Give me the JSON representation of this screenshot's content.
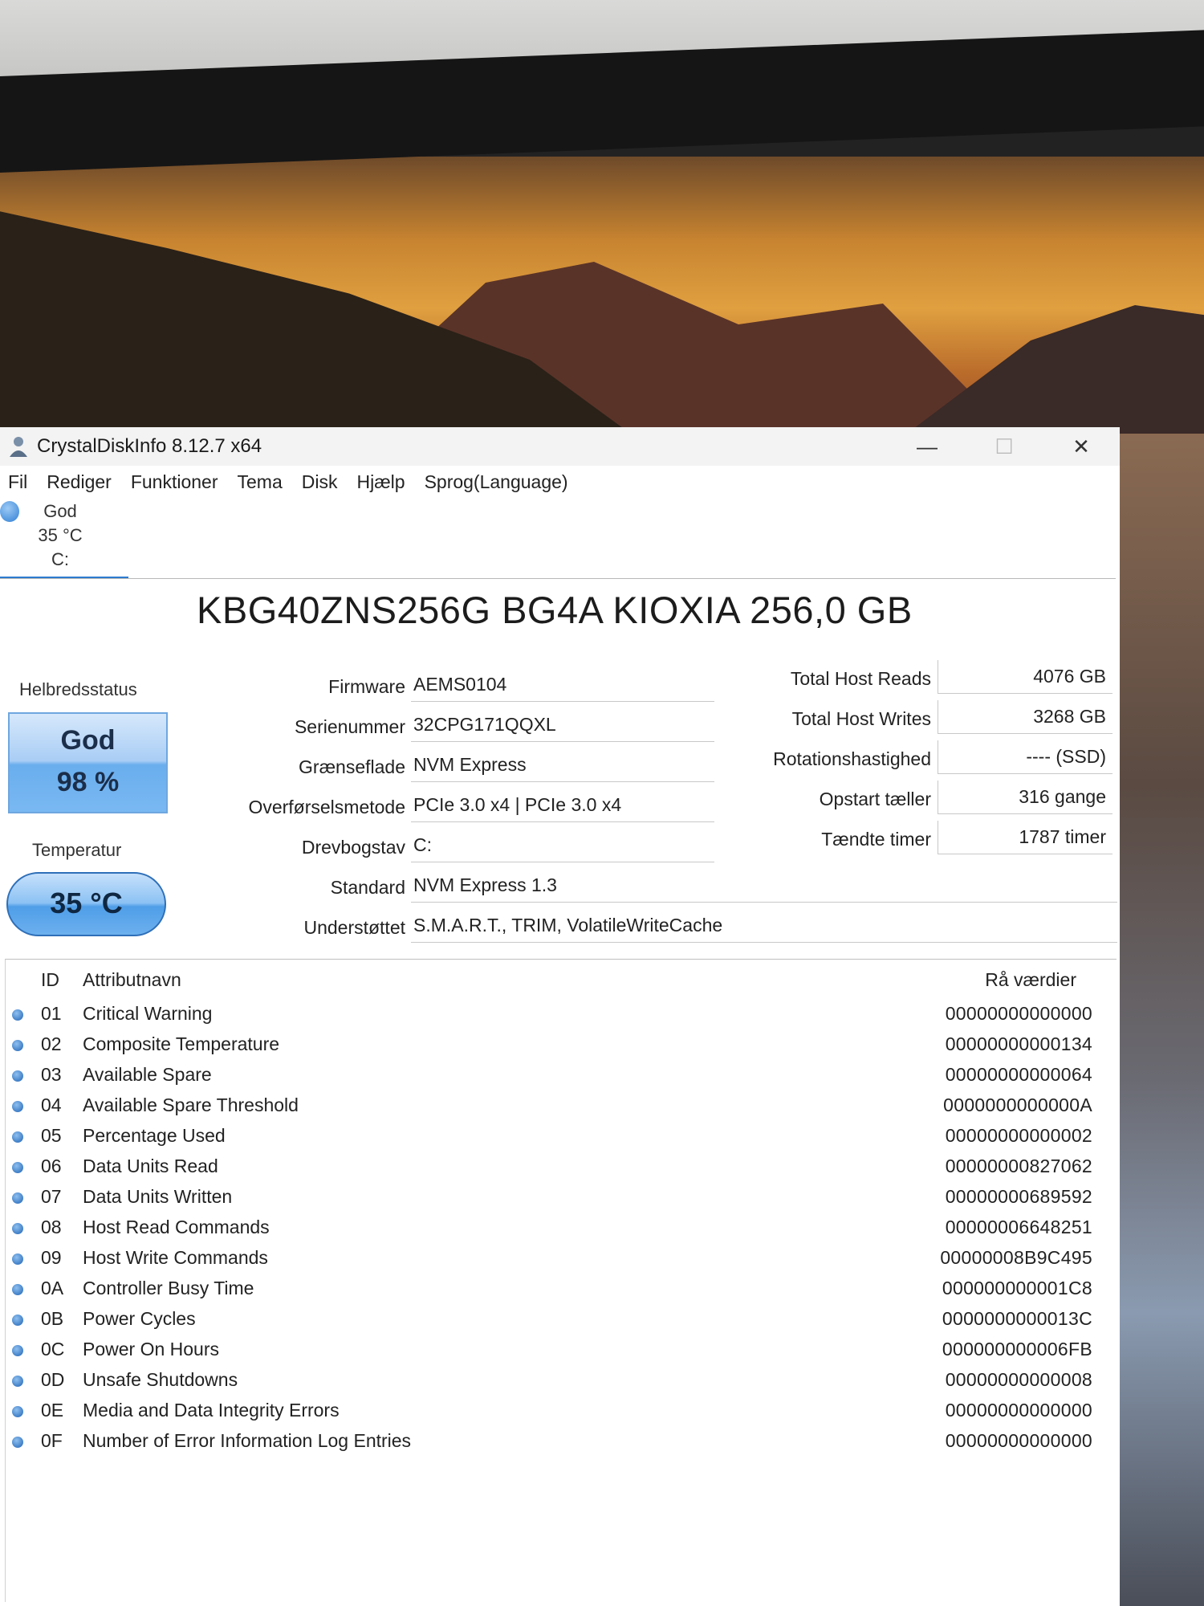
{
  "window": {
    "title": "CrystalDiskInfo 8.12.7 x64",
    "controls": {
      "minimize": "—",
      "maximize": "☐",
      "close": "✕"
    }
  },
  "menu": [
    "Fil",
    "Rediger",
    "Funktioner",
    "Tema",
    "Disk",
    "Hjælp",
    "Sprog(Language)"
  ],
  "drive_tab": {
    "status": "God",
    "temp": "35 °C",
    "letter": "C:"
  },
  "model": "KBG40ZNS256G BG4A KIOXIA 256,0 GB",
  "health": {
    "label": "Helbredsstatus",
    "status": "God",
    "percent": "98 %"
  },
  "temperature": {
    "label": "Temperatur",
    "value": "35 °C"
  },
  "info_left": [
    {
      "label": "Firmware",
      "value": "AEMS0104"
    },
    {
      "label": "Serienummer",
      "value": "32CPG171QQXL"
    },
    {
      "label": "Grænseflade",
      "value": "NVM Express"
    },
    {
      "label": "Overførselsmetode",
      "value": "PCIe 3.0 x4 | PCIe 3.0 x4"
    },
    {
      "label": "Drevbogstav",
      "value": "C:"
    },
    {
      "label": "Standard",
      "value": "NVM Express 1.3"
    },
    {
      "label": "Understøttet",
      "value": "S.M.A.R.T., TRIM, VolatileWriteCache"
    }
  ],
  "info_right": [
    {
      "label": "Total Host Reads",
      "value": "4076 GB"
    },
    {
      "label": "Total Host Writes",
      "value": "3268 GB"
    },
    {
      "label": "Rotationshastighed",
      "value": "---- (SSD)"
    },
    {
      "label": "Opstart tæller",
      "value": "316 gange"
    },
    {
      "label": "Tændte timer",
      "value": "1787 timer"
    }
  ],
  "smart": {
    "headers": {
      "id": "ID",
      "name": "Attributnavn",
      "raw": "Rå værdier"
    },
    "rows": [
      {
        "id": "01",
        "name": "Critical Warning",
        "raw": "00000000000000"
      },
      {
        "id": "02",
        "name": "Composite Temperature",
        "raw": "00000000000134"
      },
      {
        "id": "03",
        "name": "Available Spare",
        "raw": "00000000000064"
      },
      {
        "id": "04",
        "name": "Available Spare Threshold",
        "raw": "0000000000000A"
      },
      {
        "id": "05",
        "name": "Percentage Used",
        "raw": "00000000000002"
      },
      {
        "id": "06",
        "name": "Data Units Read",
        "raw": "00000000827062"
      },
      {
        "id": "07",
        "name": "Data Units Written",
        "raw": "00000000689592"
      },
      {
        "id": "08",
        "name": "Host Read Commands",
        "raw": "00000006648251"
      },
      {
        "id": "09",
        "name": "Host Write Commands",
        "raw": "00000008B9C495"
      },
      {
        "id": "0A",
        "name": "Controller Busy Time",
        "raw": "000000000001C8"
      },
      {
        "id": "0B",
        "name": "Power Cycles",
        "raw": "0000000000013C"
      },
      {
        "id": "0C",
        "name": "Power On Hours",
        "raw": "000000000006FB"
      },
      {
        "id": "0D",
        "name": "Unsafe Shutdowns",
        "raw": "00000000000008"
      },
      {
        "id": "0E",
        "name": "Media and Data Integrity Errors",
        "raw": "00000000000000"
      },
      {
        "id": "0F",
        "name": "Number of Error Information Log Entries",
        "raw": "00000000000000"
      }
    ]
  }
}
